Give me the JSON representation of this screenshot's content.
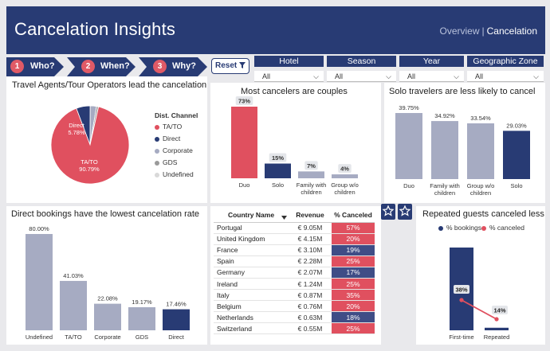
{
  "header": {
    "title": "Cancelation Insights",
    "nav_overview": "Overview",
    "nav_sep": "|",
    "nav_current": "Cancelation"
  },
  "steps": [
    {
      "num": "1",
      "label": "Who?"
    },
    {
      "num": "2",
      "label": "When?"
    },
    {
      "num": "3",
      "label": "Why?"
    }
  ],
  "reset_label": "Reset",
  "slicers": [
    {
      "label": "Hotel",
      "value": "All"
    },
    {
      "label": "Season",
      "value": "All"
    },
    {
      "label": "Year",
      "value": "All"
    },
    {
      "label": "Geographic Zone",
      "value": "All"
    }
  ],
  "colors": {
    "navy": "#283b74",
    "red": "#e0505f",
    "gray": "#a6abc2",
    "light": "#d9d9d9"
  },
  "dist_channel": {
    "title": "Travel Agents/Tour Operators lead the cancelation",
    "legend_title": "Dist. Channel",
    "legend": [
      "TA/TO",
      "Direct",
      "Corporate",
      "GDS",
      "Undefined"
    ],
    "label_direct": "Direct",
    "label_direct_pct": "5.78%",
    "label_tato": "TA/TO",
    "label_tato_pct": "90.79%"
  },
  "chart_data": [
    {
      "type": "pie",
      "categories": [
        "TA/TO",
        "Direct",
        "Corporate",
        "GDS",
        "Undefined"
      ],
      "values": [
        90.79,
        5.78,
        2.6,
        0.8,
        0.03
      ],
      "title": "Travel Agents/Tour Operators lead the cancelation"
    },
    {
      "type": "bar",
      "title": "Most cancelers are couples",
      "categories": [
        "Duo",
        "Solo",
        "Family with children",
        "Group w/o children"
      ],
      "values": [
        73,
        15,
        7,
        4
      ],
      "labels": [
        "73%",
        "15%",
        "7%",
        "4%"
      ]
    },
    {
      "type": "bar",
      "title": "Solo travelers are less likely to cancel",
      "categories": [
        "Duo",
        "Family with children",
        "Group w/o children",
        "Solo"
      ],
      "values": [
        39.75,
        34.92,
        33.54,
        29.03
      ],
      "labels": [
        "39.75%",
        "34.92%",
        "33.54%",
        "29.03%"
      ]
    },
    {
      "type": "bar",
      "title": "Direct bookings have the lowest cancelation rate",
      "categories": [
        "Undefined",
        "TA/TO",
        "Corporate",
        "GDS",
        "Direct"
      ],
      "values": [
        80.0,
        41.03,
        22.08,
        19.17,
        17.46
      ],
      "labels": [
        "80.00%",
        "41.03%",
        "22.08%",
        "19.17%",
        "17.46%"
      ]
    },
    {
      "type": "table",
      "columns": [
        "Country Name",
        "Revenue",
        "% Canceled"
      ],
      "rows": [
        [
          "Portugal",
          "€ 9.05M",
          "57%"
        ],
        [
          "United Kingdom",
          "€ 4.15M",
          "20%"
        ],
        [
          "France",
          "€ 3.10M",
          "19%"
        ],
        [
          "Spain",
          "€ 2.28M",
          "25%"
        ],
        [
          "Germany",
          "€ 2.07M",
          "17%"
        ],
        [
          "Ireland",
          "€ 1.24M",
          "25%"
        ],
        [
          "Italy",
          "€ 0.87M",
          "35%"
        ],
        [
          "Belgium",
          "€ 0.76M",
          "20%"
        ],
        [
          "Netherlands",
          "€ 0.63M",
          "18%"
        ],
        [
          "Switzerland",
          "€ 0.55M",
          "25%"
        ]
      ]
    },
    {
      "type": "bar",
      "title": "Repeated guests canceled less",
      "categories": [
        "First-time",
        "Repeated"
      ],
      "series": [
        {
          "name": "% bookings",
          "values": [
            97,
            3
          ]
        },
        {
          "name": "% canceled",
          "values": [
            38,
            14
          ]
        }
      ],
      "line_labels": [
        "38%",
        "14%"
      ],
      "legend": [
        "% bookings",
        "% canceled"
      ]
    }
  ],
  "table_row_colors": [
    "red",
    "red",
    "navy",
    "red",
    "navy",
    "red",
    "red",
    "red",
    "navy",
    "red"
  ]
}
